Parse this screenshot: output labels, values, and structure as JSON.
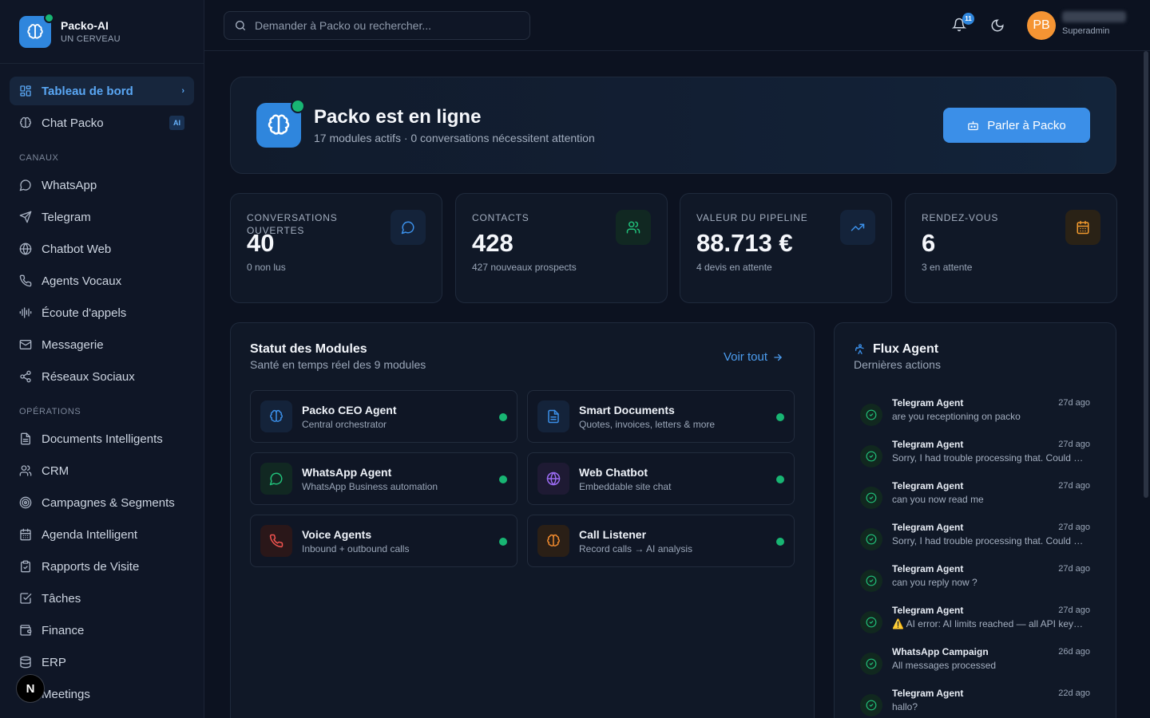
{
  "brand": {
    "name": "Packo-AI",
    "subtitle": "UN CERVEAU"
  },
  "nav": {
    "top": [
      {
        "label": "Tableau de bord",
        "icon": "dashboard-icon",
        "active": true
      },
      {
        "label": "Chat Packo",
        "icon": "brain-icon",
        "badge": "AI"
      }
    ],
    "channels_title": "CANAUX",
    "channels": [
      {
        "label": "WhatsApp",
        "icon": "chat-bubble-icon"
      },
      {
        "label": "Telegram",
        "icon": "send-icon"
      },
      {
        "label": "Chatbot Web",
        "icon": "globe-icon"
      },
      {
        "label": "Agents Vocaux",
        "icon": "phone-icon"
      },
      {
        "label": "Écoute d'appels",
        "icon": "audio-wave-icon"
      },
      {
        "label": "Messagerie",
        "icon": "mail-icon"
      },
      {
        "label": "Réseaux Sociaux",
        "icon": "share-icon"
      }
    ],
    "operations_title": "OPÉRATIONS",
    "operations": [
      {
        "label": "Documents Intelligents",
        "icon": "document-icon"
      },
      {
        "label": "CRM",
        "icon": "users-icon"
      },
      {
        "label": "Campagnes & Segments",
        "icon": "target-icon"
      },
      {
        "label": "Agenda Intelligent",
        "icon": "calendar-icon"
      },
      {
        "label": "Rapports de Visite",
        "icon": "clipboard-icon"
      },
      {
        "label": "Tâches",
        "icon": "checkbox-icon"
      },
      {
        "label": "Finance",
        "icon": "wallet-icon"
      },
      {
        "label": "ERP",
        "icon": "database-icon"
      },
      {
        "label": "Meetings",
        "icon": "video-icon"
      }
    ]
  },
  "topbar": {
    "search_placeholder": "Demander à Packo ou rechercher...",
    "notification_count": "11",
    "avatar_initials": "PB",
    "user_role": "Superadmin"
  },
  "hero": {
    "title": "Packo est en ligne",
    "subtitle": "17 modules actifs · 0 conversations nécessitent attention",
    "button_label": "Parler à Packo"
  },
  "stats": [
    {
      "label": "CONVERSATIONS OUVERTES",
      "value": "40",
      "note": "0 non lus",
      "icon": "message-icon",
      "color": "#3b8fe8",
      "bg": "#14233a"
    },
    {
      "label": "CONTACTS",
      "value": "428",
      "note": "427 nouveaux prospects",
      "icon": "users-icon",
      "color": "#21c07a",
      "bg": "#112822"
    },
    {
      "label": "VALEUR DU PIPELINE",
      "value": "88.713 €",
      "note": "4 devis en attente",
      "icon": "trending-up-icon",
      "color": "#3b8fe8",
      "bg": "#14233a"
    },
    {
      "label": "RENDEZ-VOUS",
      "value": "6",
      "note": "3 en attente",
      "icon": "calendar-icon",
      "color": "#f29a2e",
      "bg": "#2a2216"
    }
  ],
  "modules": {
    "title": "Statut des Modules",
    "subtitle": "Santé en temps réel des 9 modules",
    "see_all": "Voir tout",
    "items": [
      {
        "name": "Packo CEO Agent",
        "desc": "Central orchestrator",
        "icon": "brain-icon",
        "color": "#3b8fe8",
        "bg": "#14233a"
      },
      {
        "name": "Smart Documents",
        "desc": "Quotes, invoices, letters & more",
        "icon": "document-icon",
        "color": "#3b8fe8",
        "bg": "#14233a"
      },
      {
        "name": "WhatsApp Agent",
        "desc": "WhatsApp Business automation",
        "icon": "chat-bubble-icon",
        "color": "#21c07a",
        "bg": "#112822"
      },
      {
        "name": "Web Chatbot",
        "desc": "Embeddable site chat",
        "icon": "globe-icon",
        "color": "#9b6bf2",
        "bg": "#1e1a33"
      },
      {
        "name": "Voice Agents",
        "desc": "Inbound + outbound calls",
        "icon": "phone-icon",
        "color": "#f0534f",
        "bg": "#2a1719"
      },
      {
        "name": "Call Listener",
        "desc": "Record calls → AI analysis",
        "icon": "brain-icon",
        "color": "#f08a2e",
        "bg": "#2a1f16"
      }
    ]
  },
  "flux": {
    "title": "Flux Agent",
    "subtitle": "Dernières actions",
    "items": [
      {
        "source": "Telegram Agent",
        "time": "27d ago",
        "message": "are you receptioning on packo"
      },
      {
        "source": "Telegram Agent",
        "time": "27d ago",
        "message": "Sorry, I had trouble processing that. Could you try again?"
      },
      {
        "source": "Telegram Agent",
        "time": "27d ago",
        "message": "can you now read me"
      },
      {
        "source": "Telegram Agent",
        "time": "27d ago",
        "message": "Sorry, I had trouble processing that. Could you try again?"
      },
      {
        "source": "Telegram Agent",
        "time": "27d ago",
        "message": "can you reply now ?"
      },
      {
        "source": "Telegram Agent",
        "time": "27d ago",
        "message": "⚠️ AI error: AI limits reached — all API keys exhausted"
      },
      {
        "source": "WhatsApp Campaign",
        "time": "26d ago",
        "message": "All messages processed"
      },
      {
        "source": "Telegram Agent",
        "time": "22d ago",
        "message": "hallo?"
      }
    ]
  },
  "colors": {
    "accent": "#3b8fe8",
    "success": "#18b573",
    "background": "#0c1220"
  }
}
